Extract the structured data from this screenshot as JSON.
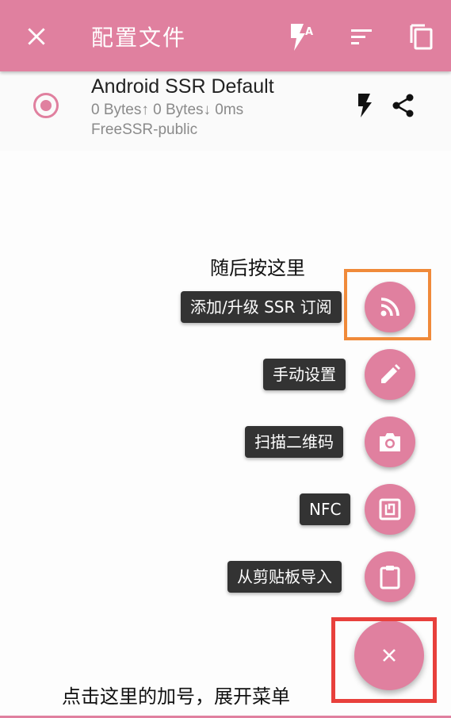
{
  "toolbar": {
    "title": "配置文件",
    "close_icon": "close-icon",
    "test_all_icon": "flash-auto-icon",
    "sort_icon": "sort-icon",
    "copy_icon": "copy-icon"
  },
  "profile": {
    "name": "Android SSR Default",
    "stats": "0 Bytes↑  0 Bytes↓  0ms",
    "group": "FreeSSR-public",
    "selected": true
  },
  "annotations": {
    "top_hint": "随后按这里",
    "bottom_hint": "点击这里的加号，展开菜单"
  },
  "fab_menu": {
    "items": [
      {
        "label": "添加/升级 SSR 订阅",
        "icon": "rss-icon"
      },
      {
        "label": "手动设置",
        "icon": "pencil-icon"
      },
      {
        "label": "扫描二维码",
        "icon": "camera-icon"
      },
      {
        "label": "NFC",
        "icon": "nfc-icon"
      },
      {
        "label": "从剪贴板导入",
        "icon": "clipboard-icon"
      }
    ],
    "main_icon": "close-icon"
  },
  "colors": {
    "accent": "#e0809f",
    "highlight_orange": "#f08a3a",
    "highlight_red": "#e8403c",
    "label_bg": "#333333"
  }
}
